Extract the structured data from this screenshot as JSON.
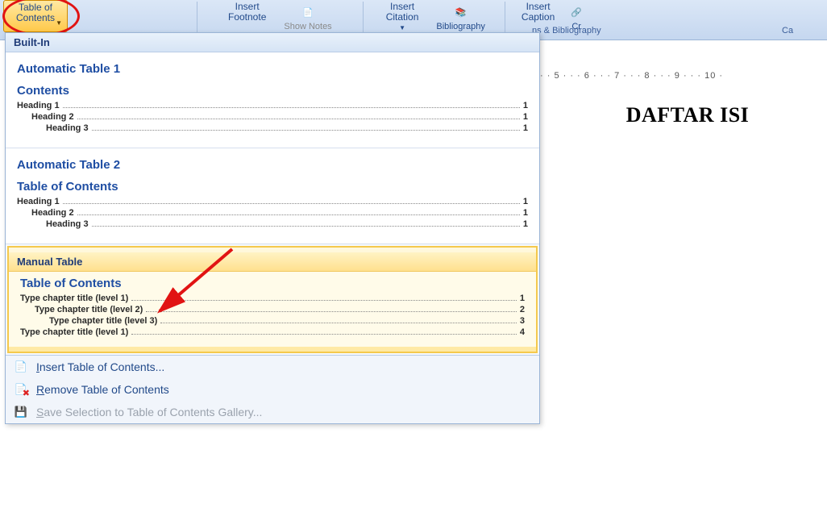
{
  "ribbon": {
    "toc_button": "Table of\nContents",
    "insert_footnote": "Insert\nFootnote",
    "show_notes": "Show Notes",
    "insert_citation": "Insert\nCitation",
    "bibliography": "Bibliography",
    "insert_caption": "Insert\nCaption",
    "cross_ref_partial": "Cr",
    "group_citations": "ns & Bibliography",
    "group_captions": "Ca"
  },
  "ruler_text": "· · 5 · · · 6 · · · 7 · · · 8 · · · 9 · · · 10 ·",
  "document": {
    "title": "DAFTAR ISI"
  },
  "gallery": {
    "header": "Built-In",
    "items": [
      {
        "title": "Automatic Table 1",
        "subtitle": "Contents",
        "lines": [
          {
            "lv": 1,
            "label": "Heading 1",
            "page": "1"
          },
          {
            "lv": 2,
            "label": "Heading 2",
            "page": "1"
          },
          {
            "lv": 3,
            "label": "Heading 3",
            "page": "1"
          }
        ]
      },
      {
        "title": "Automatic Table 2",
        "subtitle": "Table of Contents",
        "lines": [
          {
            "lv": 1,
            "label": "Heading 1",
            "page": "1"
          },
          {
            "lv": 2,
            "label": "Heading 2",
            "page": "1"
          },
          {
            "lv": 3,
            "label": "Heading 3",
            "page": "1"
          }
        ]
      },
      {
        "title": "Manual Table",
        "subtitle": "Table of Contents",
        "lines": [
          {
            "lv": 1,
            "label": "Type chapter title (level 1)",
            "page": "1"
          },
          {
            "lv": 2,
            "label": "Type chapter title (level 2)",
            "page": "2"
          },
          {
            "lv": 3,
            "label": "Type chapter title (level 3)",
            "page": "3"
          },
          {
            "lv": 1,
            "label": "Type chapter title (level 1)",
            "page": "4"
          }
        ]
      }
    ],
    "footer": {
      "insert": "Insert Table of Contents...",
      "remove": "Remove Table of Contents",
      "save": "Save Selection to Table of Contents Gallery..."
    }
  }
}
